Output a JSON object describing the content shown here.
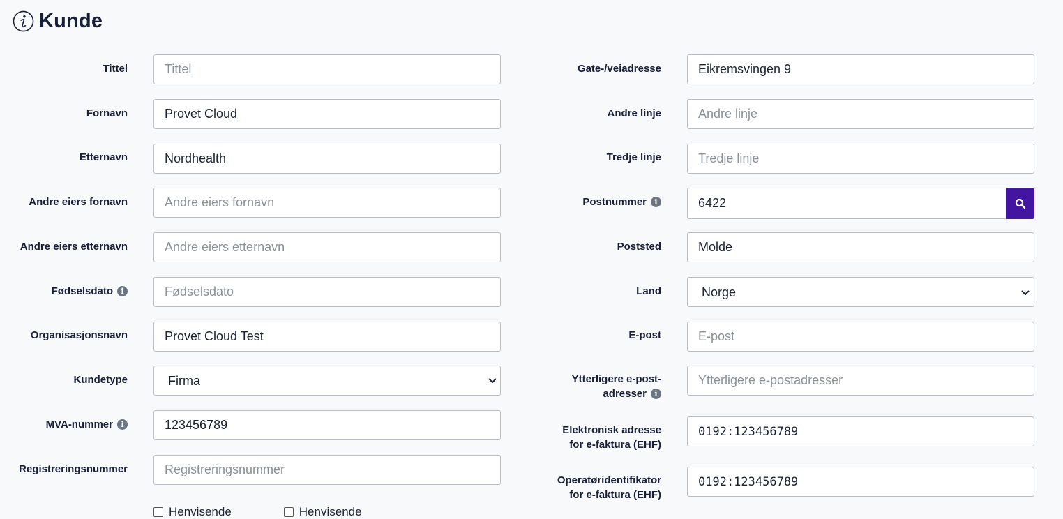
{
  "page": {
    "title": "Kunde"
  },
  "left": {
    "tittel": {
      "label": "Tittel",
      "value": "",
      "placeholder": "Tittel"
    },
    "fornavn": {
      "label": "Fornavn",
      "value": "Provet Cloud",
      "placeholder": ""
    },
    "etternavn": {
      "label": "Etternavn",
      "value": "Nordhealth",
      "placeholder": ""
    },
    "andre_fornavn": {
      "label": "Andre eiers fornavn",
      "value": "",
      "placeholder": "Andre eiers fornavn"
    },
    "andre_etternavn": {
      "label": "Andre eiers etternavn",
      "value": "",
      "placeholder": "Andre eiers etternavn"
    },
    "fodselsdato": {
      "label": "Fødselsdato",
      "value": "",
      "placeholder": "Fødselsdato"
    },
    "organisasjonsnavn": {
      "label": "Organisasjonsnavn",
      "value": "Provet Cloud Test",
      "placeholder": ""
    },
    "kundetype": {
      "label": "Kundetype",
      "selected": "Firma"
    },
    "mva": {
      "label": "MVA-nummer",
      "value": "123456789",
      "placeholder": ""
    },
    "registreringsnummer": {
      "label": "Registreringsnummer",
      "value": "",
      "placeholder": "Registreringsnummer"
    },
    "checkboxes": [
      {
        "label": "Henvisende"
      },
      {
        "label": "Henvisende"
      }
    ]
  },
  "right": {
    "gate": {
      "label": "Gate-/veiadresse",
      "value": "Eikremsvingen 9",
      "placeholder": ""
    },
    "andre_linje": {
      "label": "Andre linje",
      "value": "",
      "placeholder": "Andre linje"
    },
    "tredje_linje": {
      "label": "Tredje linje",
      "value": "",
      "placeholder": "Tredje linje"
    },
    "postnummer": {
      "label": "Postnummer",
      "value": "6422",
      "placeholder": ""
    },
    "poststed": {
      "label": "Poststed",
      "value": "Molde",
      "placeholder": ""
    },
    "land": {
      "label": "Land",
      "selected": "Norge"
    },
    "epost": {
      "label": "E-post",
      "value": "",
      "placeholder": "E-post"
    },
    "ytterligere": {
      "label_line1": "Ytterligere e-post-",
      "label_line2": "adresser",
      "value": "",
      "placeholder": "Ytterligere e-postadresser"
    },
    "ehf_adresse": {
      "label_line1": "Elektronisk adresse",
      "label_line2": "for e-faktura (EHF)",
      "value": "0192:123456789",
      "placeholder": ""
    },
    "ehf_operator": {
      "label_line1": "Operatøridentifikator",
      "label_line2": "for e-faktura (EHF)",
      "value": "0192:123456789",
      "placeholder": ""
    }
  },
  "colors": {
    "accent": "#4216a0",
    "text": "#172038",
    "border": "#b9bec5",
    "background": "#f8f9fa"
  },
  "icons": {
    "title": "info-circle-icon",
    "field_help": "info-icon",
    "search": "search-icon",
    "select": "chevron-down-icon"
  }
}
